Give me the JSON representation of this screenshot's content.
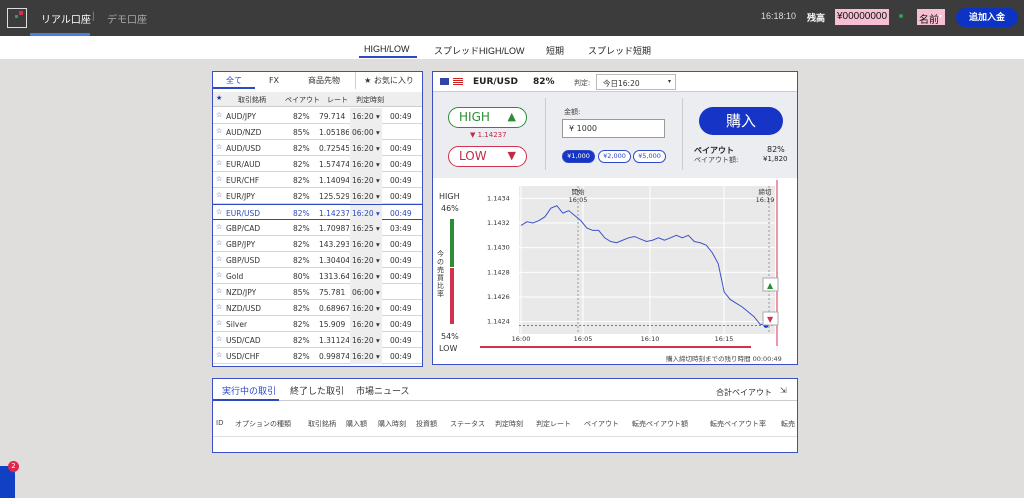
{
  "header": {
    "real_account": "リアル口座",
    "separator": "|",
    "demo_account": "デモ口座",
    "time": "16:18:10",
    "balance_label": "残高",
    "balance_value": "¥00000000",
    "name": "名前",
    "deposit": "追加入金"
  },
  "tabs": [
    "HIGH/LOW",
    "スプレッドHIGH/LOW",
    "短期",
    "スプレッド短期"
  ],
  "asset_list": {
    "tabs": [
      "全て",
      "FX",
      "商品先物",
      "★ お気に入り"
    ],
    "columns": [
      "取引銘柄",
      "ペイアウト",
      "レート",
      "判定時刻"
    ],
    "rows": [
      {
        "name": "AUD/JPY",
        "payout": "82%",
        "rate": "79.714",
        "expiry": "16:20 ▾",
        "remaining": "00:49"
      },
      {
        "name": "AUD/NZD",
        "payout": "85%",
        "rate": "1.05186",
        "expiry": "06:00 ▾",
        "remaining": ""
      },
      {
        "name": "AUD/USD",
        "payout": "82%",
        "rate": "0.72545",
        "expiry": "16:20 ▾",
        "remaining": "00:49"
      },
      {
        "name": "EUR/AUD",
        "payout": "82%",
        "rate": "1.57474",
        "expiry": "16:20 ▾",
        "remaining": "00:49"
      },
      {
        "name": "EUR/CHF",
        "payout": "82%",
        "rate": "1.14094",
        "expiry": "16:20 ▾",
        "remaining": "00:49"
      },
      {
        "name": "EUR/JPY",
        "payout": "82%",
        "rate": "125.529",
        "expiry": "16:20 ▾",
        "remaining": "00:49"
      },
      {
        "name": "EUR/USD",
        "payout": "82%",
        "rate": "1.14237",
        "expiry": "16:20 ▾",
        "remaining": "00:49",
        "selected": true
      },
      {
        "name": "GBP/CAD",
        "payout": "82%",
        "rate": "1.70987",
        "expiry": "16:25 ▾",
        "remaining": "03:49"
      },
      {
        "name": "GBP/JPY",
        "payout": "82%",
        "rate": "143.293",
        "expiry": "16:20 ▾",
        "remaining": "00:49"
      },
      {
        "name": "GBP/USD",
        "payout": "82%",
        "rate": "1.30404",
        "expiry": "16:20 ▾",
        "remaining": "00:49"
      },
      {
        "name": "Gold",
        "payout": "80%",
        "rate": "1313.64",
        "expiry": "16:20 ▾",
        "remaining": "00:49"
      },
      {
        "name": "NZD/JPY",
        "payout": "85%",
        "rate": "75.781",
        "expiry": "06:00 ▾",
        "remaining": ""
      },
      {
        "name": "NZD/USD",
        "payout": "82%",
        "rate": "0.68967",
        "expiry": "16:20 ▾",
        "remaining": "00:49"
      },
      {
        "name": "Silver",
        "payout": "82%",
        "rate": "15.909",
        "expiry": "16:20 ▾",
        "remaining": "00:49"
      },
      {
        "name": "USD/CAD",
        "payout": "82%",
        "rate": "1.31124",
        "expiry": "16:20 ▾",
        "remaining": "00:49"
      },
      {
        "name": "USD/CHF",
        "payout": "82%",
        "rate": "0.99874",
        "expiry": "16:20 ▾",
        "remaining": "00:49"
      }
    ]
  },
  "trade": {
    "pair": "EUR/USD",
    "payout_pct": "82%",
    "judge_label": "判定:",
    "judge_select": "今日16:20",
    "high_label": "HIGH",
    "current_rate": "▼ 1.14237",
    "low_label": "LOW",
    "amount_label": "金額:",
    "amount_value": "¥ 1000",
    "chips": [
      "¥1,000",
      "¥2,000",
      "¥5,000"
    ],
    "buy_label": "購入",
    "payout_label": "ペイアウト",
    "payout_value": "82%",
    "payout_amount_label": "ペイアウト額:",
    "payout_amount_value": "¥1,820"
  },
  "chart": {
    "high_label": "HIGH",
    "high_pct": "46%",
    "low_pct": "54%",
    "low_label": "LOW",
    "side_label": "今の売買比率",
    "start_label": "開始",
    "start_time": "16:05",
    "end_label": "締切",
    "end_time": "16:19",
    "countdown_label": "購入締切時刻までの残り時間 00:00:49"
  },
  "chart_data": {
    "type": "line",
    "x_ticks": [
      "16:00",
      "16:05",
      "16:10",
      "16:15"
    ],
    "y_ticks": [
      "1.1434",
      "1.1432",
      "1.1430",
      "1.1428",
      "1.1426",
      "1.1424"
    ],
    "ylim": [
      1.1423,
      1.1435
    ],
    "series": [
      {
        "values": [
          1.14318,
          1.14321,
          1.1432,
          1.14322,
          1.14325,
          1.14332,
          1.14334,
          1.14328,
          1.1433,
          1.14326,
          1.14322,
          1.14316,
          1.14314,
          1.14314,
          1.14308,
          1.14305,
          1.14304,
          1.14306,
          1.14308,
          1.14309,
          1.14307,
          1.14305,
          1.14306,
          1.14308,
          1.14306,
          1.14308,
          1.1431,
          1.14308,
          1.1431,
          1.14305,
          1.14304,
          1.14302,
          1.14296,
          1.14287,
          1.14264,
          1.14258,
          1.14255,
          1.14252,
          1.14248,
          1.14244,
          1.14238,
          1.14237
        ]
      }
    ],
    "current_value": 1.14237
  },
  "trades_panel": {
    "tabs": [
      "実行中の取引",
      "終了した取引",
      "市場ニュース"
    ],
    "total_payout": "合計ペイアウト",
    "columns": [
      "ID",
      "オプションの種類",
      "取引銘柄",
      "購入額",
      "購入時刻",
      "投資額",
      "ステータス",
      "判定時刻",
      "判定レート",
      "ペイアウト",
      "転売ペイアウト額",
      "転売ペイアウト率",
      "転売"
    ]
  },
  "chat_badge": "2"
}
